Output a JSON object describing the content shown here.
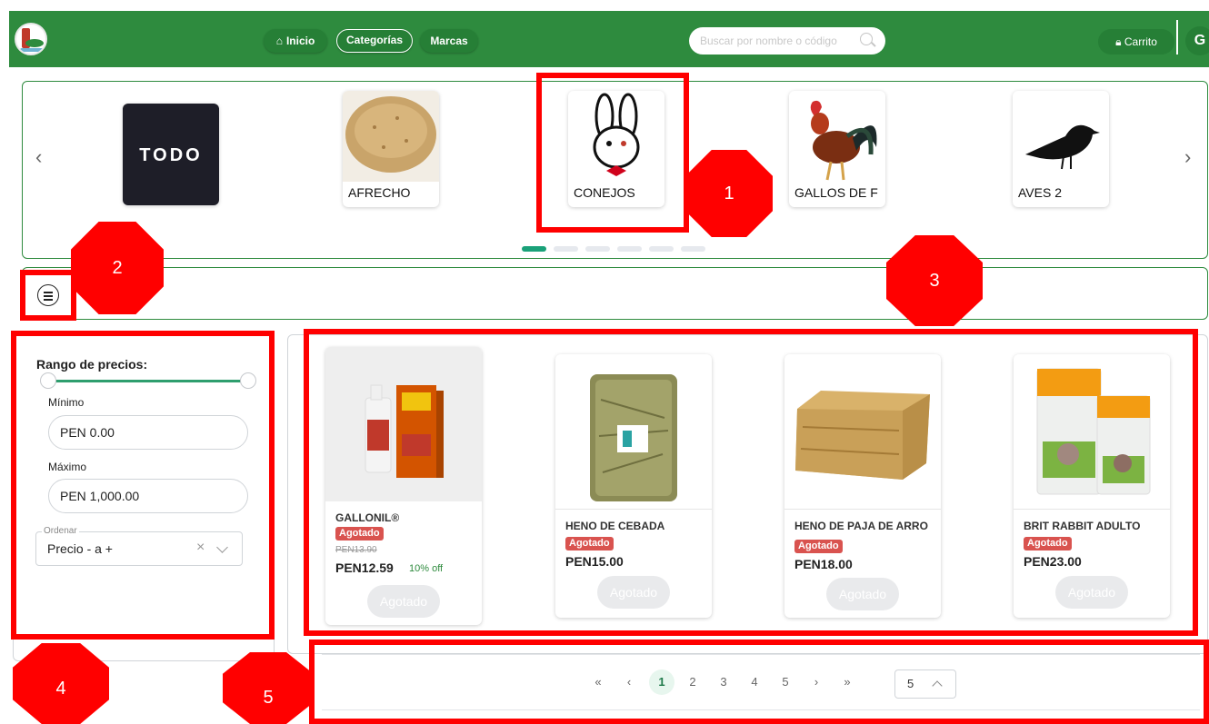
{
  "nav": {
    "home_label": "Inicio",
    "categories_label": "Categorías",
    "brands_label": "Marcas",
    "search_placeholder": "Buscar por nombre o código",
    "cart_label": "Carrito",
    "user_initial": "G",
    "brand_color": "#2e8b3e"
  },
  "carousel": {
    "categories": [
      {
        "label": "TODO",
        "image": "todo-logo"
      },
      {
        "label": "AFRECHO",
        "image": "bran-photo"
      },
      {
        "label": "CONEJOS",
        "image": "rabbit-icon"
      },
      {
        "label": "GALLOS DE F",
        "image": "rooster-photo"
      },
      {
        "label": "AVES 2",
        "image": "bird-silhouette"
      }
    ],
    "dot_count": 6,
    "active_dot": 1
  },
  "filters": {
    "price_range_title": "Rango de precios:",
    "min_label": "Mínimo",
    "min_value": "PEN 0.00",
    "max_label": "Máximo",
    "max_value": "PEN 1,000.00",
    "sort_legend": "Ordenar",
    "sort_value": "Precio - a +"
  },
  "products": [
    {
      "name": "GALLONIL®",
      "badge": "Agotado",
      "old_price": "PEN13.90",
      "price": "PEN12.59",
      "discount": "10% off",
      "button": "Agotado"
    },
    {
      "name": "HENO DE CEBADA",
      "badge": "Agotado",
      "price": "PEN15.00",
      "button": "Agotado"
    },
    {
      "name": "HENO DE PAJA DE ARRO",
      "badge": "Agotado",
      "price": "PEN18.00",
      "button": "Agotado"
    },
    {
      "name": "BRIT RABBIT ADULTO",
      "badge": "Agotado",
      "price": "PEN23.00",
      "button": "Agotado"
    }
  ],
  "pagination": {
    "first": "«",
    "prev": "‹",
    "pages": [
      "1",
      "2",
      "3",
      "4",
      "5"
    ],
    "current_page": "1",
    "next": "›",
    "last": "»",
    "page_size": "5"
  },
  "annotations": [
    "1",
    "2",
    "3",
    "4",
    "5"
  ]
}
